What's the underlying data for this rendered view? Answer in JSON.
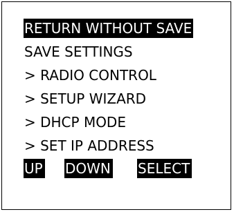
{
  "menu": {
    "items": [
      {
        "label": "RETURN WITHOUT SAVE",
        "selected": true
      },
      {
        "label": "SAVE SETTINGS",
        "selected": false
      },
      {
        "label": "> RADIO CONTROL",
        "selected": false
      },
      {
        "label": "> SETUP WIZARD",
        "selected": false
      },
      {
        "label": "> DHCP MODE",
        "selected": false
      },
      {
        "label": "> SET IP ADDRESS",
        "selected": false
      }
    ]
  },
  "softkeys": {
    "up": "UP",
    "down": "DOWN",
    "select": "SELECT"
  },
  "colors": {
    "background": "#ffffff",
    "foreground": "#000000",
    "highlight_bg": "#000000",
    "highlight_fg": "#ffffff"
  }
}
